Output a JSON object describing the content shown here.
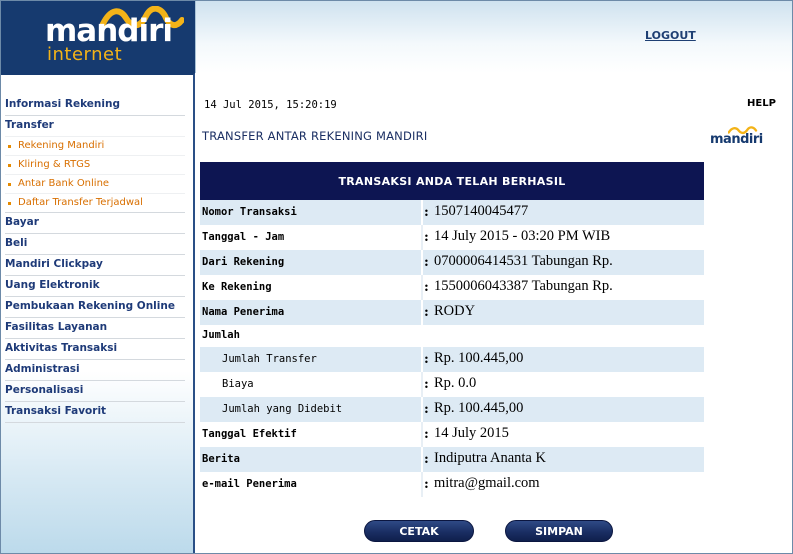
{
  "brand": {
    "logo_word": "mandiri",
    "logo_sub": "internet",
    "wave_color": "#f3b318",
    "navy": "#163a6f"
  },
  "header": {
    "logout_label": "LOGOUT"
  },
  "sidebar": {
    "items": [
      {
        "label": "Informasi Rekening",
        "type": "menu"
      },
      {
        "label": "Transfer",
        "type": "menu"
      },
      {
        "label": "Rekening Mandiri",
        "type": "sub"
      },
      {
        "label": "Kliring & RTGS",
        "type": "sub"
      },
      {
        "label": "Antar Bank Online",
        "type": "sub"
      },
      {
        "label": "Daftar Transfer Terjadwal",
        "type": "sub"
      },
      {
        "label": "Bayar",
        "type": "menu"
      },
      {
        "label": "Beli",
        "type": "menu"
      },
      {
        "label": "Mandiri Clickpay",
        "type": "menu"
      },
      {
        "label": "Uang Elektronik",
        "type": "menu"
      },
      {
        "label": "Pembukaan Rekening Online",
        "type": "menu"
      },
      {
        "label": "Fasilitas Layanan",
        "type": "menu"
      },
      {
        "label": "Aktivitas Transaksi",
        "type": "menu"
      },
      {
        "label": "Administrasi",
        "type": "menu"
      },
      {
        "label": "Personalisasi",
        "type": "menu"
      },
      {
        "label": "Transaksi Favorit",
        "type": "menu"
      }
    ]
  },
  "content": {
    "datetime": "14 Jul 2015, 15:20:19",
    "help_label": "HELP",
    "title": "TRANSFER ANTAR REKENING MANDIRI",
    "mini_logo": "mandiri",
    "result_header": "TRANSAKSI ANDA TELAH BERHASIL",
    "rows": [
      {
        "label": "Nomor Transaksi",
        "value": "1507140045477"
      },
      {
        "label": "Tanggal - Jam",
        "value": "14 July 2015 - 03:20 PM WIB"
      },
      {
        "label": "Dari Rekening",
        "value": "0700006414531 Tabungan  Rp."
      },
      {
        "label": "Ke Rekening",
        "value": "1550006043387 Tabungan Rp."
      },
      {
        "label": "Nama Penerima",
        "value": "RODY"
      },
      {
        "label": "Jumlah",
        "value": ""
      },
      {
        "label": "Jumlah Transfer",
        "value": "Rp. 100.445,00"
      },
      {
        "label": "Biaya",
        "value": "Rp. 0.0"
      },
      {
        "label": "Jumlah yang Didebit",
        "value": "Rp. 100.445,00"
      },
      {
        "label": "Tanggal Efektif",
        "value": "14 July 2015"
      },
      {
        "label": "Berita",
        "value": "Indiputra Ananta K"
      },
      {
        "label": "e-mail Penerima",
        "value": "mitra@gmail.com"
      }
    ],
    "colon": ":"
  },
  "buttons": {
    "print_label": "CETAK",
    "save_label": "SIMPAN"
  }
}
